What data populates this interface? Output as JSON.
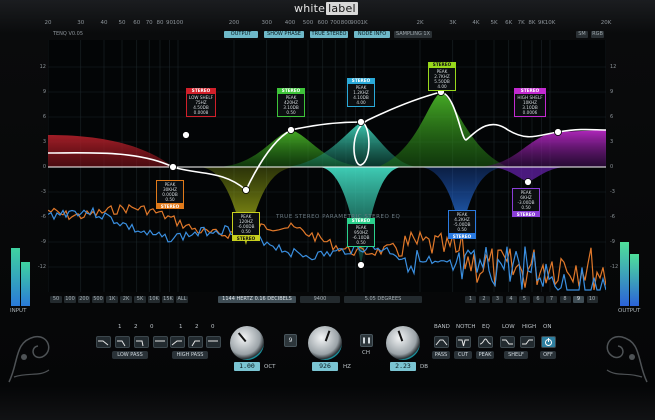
{
  "brand": {
    "white": "white",
    "label": "label"
  },
  "version": "TENQ V0.05",
  "freq_ticks_top": [
    "20",
    "30",
    "40",
    "50",
    "60",
    "70",
    "80",
    "90",
    "100",
    "200",
    "300",
    "400",
    "500",
    "600",
    "700",
    "800",
    "900",
    "1K",
    "2K",
    "3K",
    "4K",
    "5K",
    "6K",
    "7K",
    "8K",
    "9K",
    "10K",
    "20K"
  ],
  "top_buttons": {
    "output": "OUTPUT",
    "show_phase": "SHOW PHASE",
    "true_stereo": "TRUE STEREO",
    "node_info": "NODE INFO",
    "sampling": "SAMPLING 1X",
    "sm": "SM",
    "rgb": "RGB"
  },
  "db_ticks": [
    "12",
    "9",
    "6",
    "3",
    "0",
    "-3",
    "-6",
    "-9",
    "-12"
  ],
  "bottom_freqs": [
    "50",
    "100",
    "200",
    "500",
    "1K",
    "2K",
    "5K",
    "10K",
    "15K",
    "ALL"
  ],
  "readout": {
    "freq": "1144 HERTZ",
    "db": "0.16 DECIBELS",
    "x": "9400",
    "deg": "5.05 DEGREES"
  },
  "band_numbers": [
    "1",
    "2",
    "3",
    "4",
    "5",
    "6",
    "7",
    "8",
    "9",
    "10"
  ],
  "nodes": [
    {
      "head": "STEREO",
      "lines": [
        "PEAK",
        "30KHZ",
        "0.00DB",
        "0.50"
      ],
      "color": "#e07a1a"
    },
    {
      "head": "STEREO",
      "lines": [
        "LOW SHELF",
        "75HZ",
        "4.50DB",
        "0.0008"
      ],
      "color": "#d0202a"
    },
    {
      "head": "STEREO",
      "lines": [
        "PEAK",
        "120HZ",
        "-6.00DB",
        "0.50"
      ],
      "color": "#c8d01e"
    },
    {
      "head": "STEREO",
      "lines": [
        "PEAK",
        "420HZ",
        "3.10DB",
        "0.50"
      ],
      "color": "#3ec43a"
    },
    {
      "head": "STEREO",
      "lines": [
        "PEAK",
        "950HZ",
        "-6.10DB",
        "0.50"
      ],
      "color": "#2bd08c"
    },
    {
      "head": "STEREO",
      "lines": [
        "PEAK",
        "1.2KHZ",
        "4.10DB",
        "4.00"
      ],
      "color": "#2aa9d8"
    },
    {
      "head": "STEREO",
      "lines": [
        "PEAK",
        "2.7KHZ",
        "5.50DB",
        "4.00"
      ],
      "color": "#98d81c"
    },
    {
      "head": "STEREO",
      "lines": [
        "PEAK",
        "4.2KHZ",
        "-5.00DB",
        "0.50"
      ],
      "color": "#2a7ae0"
    },
    {
      "head": "STEREO",
      "lines": [
        "PEAK",
        "6KHZ",
        "-3.00DB",
        "0.50"
      ],
      "color": "#8a3ed8"
    },
    {
      "head": "STEREO",
      "lines": [
        "HIGH SHELF",
        "10KHZ",
        "3.10DB",
        "0.0006"
      ],
      "color": "#c22ad0"
    }
  ],
  "watermark": "TRUE STEREO PARAMETRIC STEREO EQ",
  "io": {
    "input": "INPUT",
    "output": "OUTPUT"
  },
  "filters": {
    "low_pass_label": "LOW PASS",
    "high_pass_label": "HIGH PASS",
    "lp_numbers": [
      "1",
      "2",
      "0"
    ],
    "hp_numbers": [
      "1",
      "2",
      "0"
    ]
  },
  "knobs": {
    "oct": {
      "value": "1.00",
      "unit": "OCT"
    },
    "hz": {
      "value": "926",
      "unit": "HZ"
    },
    "db": {
      "value": "2.23",
      "unit": "DB"
    },
    "band_index": "9",
    "ch_label": "CH"
  },
  "bandtype": {
    "headers": [
      "BAND",
      "NOTCH",
      "EQ",
      "LOW",
      "HIGH",
      "ON"
    ],
    "row2": [
      "PASS",
      "CUT",
      "PEAK",
      "SHELF",
      "OFF"
    ]
  },
  "colors": {
    "accent": "#7ac4d2",
    "curve": "#ffffff",
    "spectrum_orange": "#e0782a",
    "spectrum_blue": "#3a8fe0"
  }
}
